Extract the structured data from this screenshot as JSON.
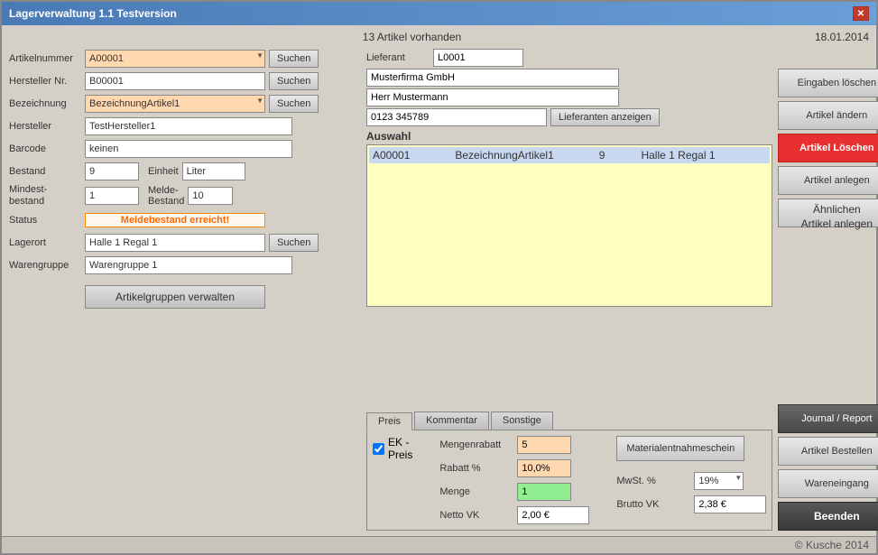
{
  "window": {
    "title": "Lagerverwaltung 1.1 Testversion",
    "close_label": "✕"
  },
  "header": {
    "article_count": "13 Artikel vorhanden",
    "date": "18.01.2014"
  },
  "form": {
    "artikelnummer_label": "Artikelnummer",
    "artikelnummer_value": "A00001",
    "hersteller_nr_label": "Hersteller Nr.",
    "hersteller_nr_value": "B00001",
    "bezeichnung_label": "Bezeichnung",
    "bezeichnung_value": "BezeichnungArtikel1",
    "hersteller_label": "Hersteller",
    "hersteller_value": "TestHersteller1",
    "barcode_label": "Barcode",
    "barcode_value": "keinen",
    "bestand_label": "Bestand",
    "bestand_value": "9",
    "einheit_label": "Einheit",
    "einheit_value": "Liter",
    "mindest_label": "Mindest-bestand",
    "mindest_value": "1",
    "melde_label": "Melde-Bestand",
    "melde_value": "10",
    "status_label": "Status",
    "status_alert": "Meldebestand erreicht!",
    "lagerort_label": "Lagerort",
    "lagerort_value": "Halle 1 Regal 1",
    "warengruppe_label": "Warengruppe",
    "warengruppe_value": "Warengruppe 1",
    "artikelgruppen_btn": "Artikelgruppen verwalten",
    "suchen_label": "Suchen"
  },
  "supplier": {
    "lieferant_label": "Lieferant",
    "lieferant_value": "L0001",
    "firma": "Musterfirma GmbH",
    "ansprechpartner": "Herr Mustermann",
    "telefon": "0123 345789",
    "lieferanten_btn": "Lieferanten anzeigen"
  },
  "auswahl": {
    "label": "Auswahl",
    "row": {
      "id": "A00001",
      "bezeichnung": "BezeichnungArtikel1",
      "menge": "9",
      "ort": "Halle 1 Regal 1"
    }
  },
  "right_buttons": {
    "eingaben_loeschen": "Eingaben löschen",
    "artikel_aendern": "Artikel ändern",
    "artikel_loeschen": "Artikel Löschen",
    "artikel_anlegen": "Artikel anlegen",
    "aehnlichen_label1": "Ähnlichen",
    "aehnlichen_label2": "Artikel anlegen",
    "journal_report": "Journal / Report",
    "artikel_bestellen": "Artikel Bestellen",
    "wareneingang": "Wareneingang",
    "beenden": "Beenden"
  },
  "tabs": {
    "preis_label": "Preis",
    "kommentar_label": "Kommentar",
    "sonstige_label": "Sonstige"
  },
  "preis_tab": {
    "ek_preis_label": "EK - Preis",
    "mengenrabatt_label": "Mengenrabatt",
    "mengenrabatt_value": "5",
    "rabatt_label": "Rabatt %",
    "rabatt_value": "10,0%",
    "menge_label": "Menge",
    "menge_value": "1",
    "netto_label": "Netto VK",
    "netto_value": "2,00 €",
    "materialschein_btn": "Materialentnahmeschein",
    "mwst_label": "MwSt. %",
    "mwst_value": "19%",
    "brutto_label": "Brutto VK",
    "brutto_value": "2,38 €"
  },
  "footer": {
    "copyright": "© Kusche 2014"
  }
}
